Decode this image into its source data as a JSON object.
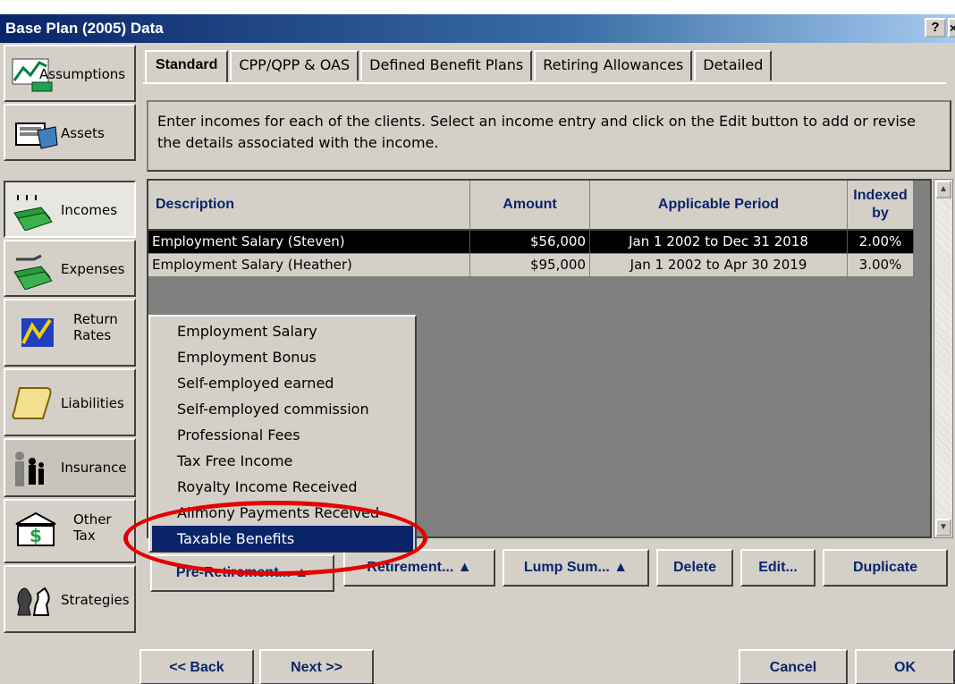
{
  "window": {
    "title": "Base Plan (2005) Data",
    "help": "?",
    "close": "×"
  },
  "sidebar": {
    "items": [
      {
        "label": "Assumptions",
        "icon": "assumptions-chart-icon"
      },
      {
        "label": "Assets",
        "icon": "assets-folder-icon"
      },
      {
        "label": "Incomes",
        "icon": "money-incomes-icon"
      },
      {
        "label": "Expenses",
        "icon": "money-expenses-icon"
      },
      {
        "label": "Return",
        "label2": "Rates",
        "icon": "return-rates-chart-icon"
      },
      {
        "label": "Liabilities",
        "icon": "scroll-icon"
      },
      {
        "label": "Insurance",
        "icon": "family-icon"
      },
      {
        "label": "Other",
        "label2": "Tax",
        "icon": "bank-dollar-icon"
      },
      {
        "label": "Strategies",
        "icon": "chess-icon"
      }
    ]
  },
  "tabs": [
    "Standard",
    "CPP/QPP & OAS",
    "Defined Benefit Plans",
    "Retiring Allowances",
    "Detailed"
  ],
  "instructions": "Enter incomes for each of the clients. Select an income entry and click on the Edit button to add or revise the details associated with the income.",
  "table": {
    "headers": {
      "description": "Description",
      "amount": "Amount",
      "period": "Applicable Period",
      "indexed": "Indexed by"
    },
    "rows": [
      {
        "description": "Employment Salary (Steven)",
        "amount": "$56,000",
        "period": "Jan 1 2002 to Dec 31 2018",
        "indexed": "2.00%"
      },
      {
        "description": "Employment Salary (Heather)",
        "amount": "$95,000",
        "period": "Jan 1 2002 to Apr 30 2019",
        "indexed": "3.00%"
      }
    ]
  },
  "menu": {
    "items": [
      "Employment Salary",
      "Employment Bonus",
      "Self-employed earned",
      "Self-employed commission",
      "Professional Fees",
      "Tax Free Income",
      "Royalty Income Received",
      "Alimony Payments Received",
      "Taxable Benefits"
    ],
    "highlighted": "Taxable Benefits"
  },
  "buttons": {
    "pre_retirement": "Pre-Retirement... ▲",
    "retirement": "Retirement... ▲",
    "lump_sum": "Lump Sum... ▲",
    "delete": "Delete",
    "edit": "Edit...",
    "duplicate": "Duplicate",
    "back": "<< Back",
    "next": "Next >>",
    "cancel": "Cancel",
    "ok": "OK"
  },
  "colors": {
    "titlebar": "#0a246a",
    "header_text": "#0a246a",
    "highlight_oval": "#e30000",
    "selected_row": "#000000"
  }
}
